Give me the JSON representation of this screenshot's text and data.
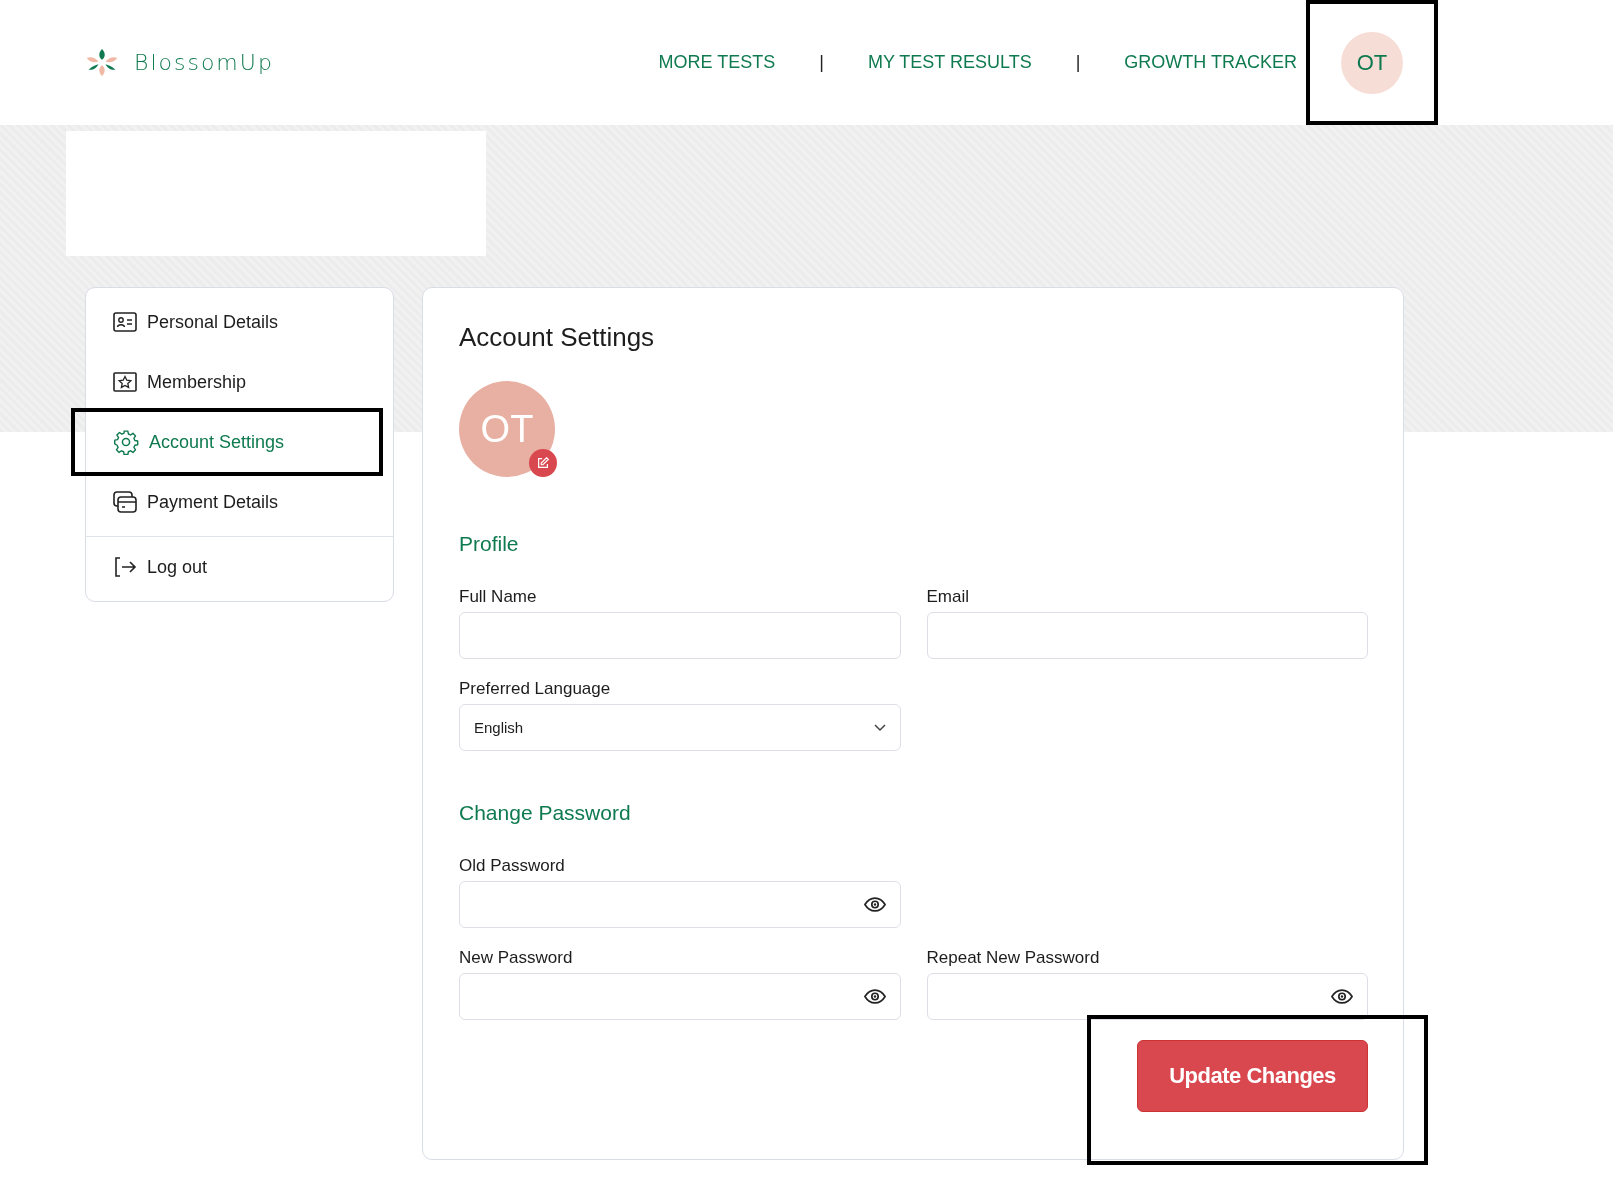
{
  "header": {
    "logo": "BlossomUp",
    "nav": [
      {
        "kind": "link",
        "label": "MORE TESTS"
      },
      {
        "kind": "separator",
        "label": "|"
      },
      {
        "kind": "link",
        "label": "MY TEST RESULTS"
      },
      {
        "kind": "separator",
        "label": "|"
      },
      {
        "kind": "link",
        "label": "GROWTH TRACKER"
      }
    ],
    "avatar": {
      "initials": "OT",
      "highlighted": true
    }
  },
  "sidebar": {
    "items": [
      {
        "label": "Personal Details",
        "kind": "page",
        "selected": false,
        "highlighted": false
      },
      {
        "label": "Membership",
        "kind": "page",
        "selected": false,
        "highlighted": false
      },
      {
        "label": "Account Settings",
        "kind": "page",
        "selected": true,
        "highlighted": true
      },
      {
        "label": "Payment Details",
        "kind": "page",
        "selected": false,
        "highlighted": false
      },
      {
        "label": "Log out",
        "kind": "action",
        "selected": false,
        "highlighted": false
      }
    ]
  },
  "card": {
    "title": "Account Settings",
    "avatar": {
      "initials": "OT"
    },
    "sections": [
      {
        "heading": "Profile",
        "rows": [
          [
            {
              "label": "Full Name",
              "kind": "text"
            },
            {
              "label": "Email",
              "kind": "text"
            }
          ],
          [
            {
              "label": "Preferred Language",
              "kind": "select",
              "value": "English"
            }
          ]
        ]
      },
      {
        "heading": "Change Password",
        "rows": [
          [
            {
              "label": "Old Password",
              "kind": "password"
            }
          ],
          [
            {
              "label": "New Password",
              "kind": "password"
            },
            {
              "label": "Repeat New Password",
              "kind": "password"
            }
          ]
        ]
      }
    ],
    "button": {
      "label": "Update Changes",
      "highlighted": true
    }
  }
}
